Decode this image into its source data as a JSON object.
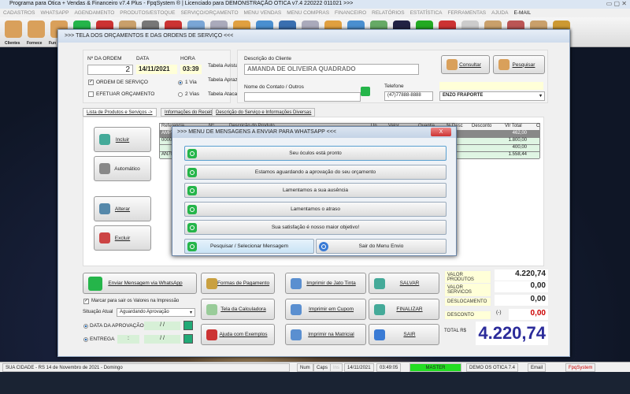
{
  "app": {
    "title": "Programa para Otica + Vendas & Financeiro v7.4 Plus - FpqSystem ® | Licenciado para  DEMONSTRAÇÃO OTICA v7.4 220222 011021 >>>"
  },
  "menu": [
    "CADASTROS",
    "WHATSAPP",
    "AGENDAMENTO",
    "PRODUTOS/ESTOQUE",
    "SERVIÇO/ORÇAMENTO",
    "MENU VENDAS",
    "MENU COMPRAS",
    "FINANCEIRO",
    "RELATÓRIOS",
    "ESTATÍSTICA",
    "FERRAMENTAS",
    "AJUDA",
    "E-MAIL"
  ],
  "toolbar": {
    "labels": [
      "Clientes",
      "Fornece",
      "Fun"
    ]
  },
  "window": {
    "title": ">>>  TELA DOS ORÇAMENTOS E DAS ORDENS DE SERVIÇO  <<<"
  },
  "order": {
    "num_label": "Nº DA ORDEM",
    "num": "2",
    "date_label": "DATA",
    "date": "14/11/2021",
    "time_label": "HORA",
    "time": "03:39",
    "os_label": "ORDEM DE SERVIÇO",
    "orc_label": "EFETUAR ORÇAMENTO",
    "via1": "1 Via",
    "via2": "2 Vias",
    "t_avista": "Tabela Avista",
    "t_aprazo": "Tabela Aprazo",
    "t_atacado": "Tabela Atacado"
  },
  "client": {
    "desc_label": "Descrição do Cliente",
    "name": "AMANDA DE OLIVEIRA QUADRADO",
    "contact_label": "Nome do Contato / Outros",
    "contact": "",
    "phone_label": "Telefone",
    "phone": "(47)77888-8888",
    "seller": "ENZO FRAPORTE",
    "consultar": "Consultar",
    "pesquisar": "Pesquisar"
  },
  "tabs": [
    "Lista de Produtos e Serviços ->",
    "Informações do Receituário ->",
    "Descrição do Serviço e Informações Diversas"
  ],
  "side": {
    "incluir": "Incluir",
    "automatico": "Automático",
    "alterar": "Alterar",
    "excluir": "Excluir"
  },
  "grid": {
    "headers": [
      "Referencia",
      "Nº",
      "Descrição do Produto",
      "Un",
      "Valor",
      "Quantia",
      "% Desc",
      "Desconto",
      "Vlr Total",
      "C"
    ],
    "rows": [
      {
        "ref": "AMP",
        "total": "462,00"
      },
      {
        "ref": "00000",
        "total": "1.800,00"
      },
      {
        "ref": "",
        "total": "400,00"
      },
      {
        "ref": "AN70",
        "total": "1.558,44"
      }
    ]
  },
  "dialog": {
    "title": ">>> MENU DE MENSAGENS A ENVIAR PARA WHATSAPP <<<",
    "close": "X",
    "messages": [
      "Seu óculos está pronto",
      "Estamos aguardando a aprovação do seu orçamento",
      "Lamentamos a sua ausência",
      "Lamentamos o atraso",
      "Sua satisfação é nosso maior objetivo!"
    ],
    "search": "Pesquisar / Selecionar Mensagem",
    "exit": "Sair do Menu Envio"
  },
  "bottom": {
    "whatsapp": "Enviar Mensagem via WhatsApp",
    "marcar": "Marcar para sair os Valores na Impressão",
    "situacao_label": "Situação Atual",
    "situacao": "Aguardando Aprovação",
    "data_aprov": "DATA DA APROVAÇÃO",
    "entrega": "ENTREGA",
    "date_blank": "/ /",
    "time_blank": ":",
    "formas": "Formas de Pagamento",
    "calc": "Tela da Calculadora",
    "ajuda": "Ajuda com Exemplos",
    "jato": "Imprimir de Jato Tinta",
    "cupom": "Imprimir em Cupom",
    "matricial": "Imprimir na Matricial",
    "salvar": "SALVAR",
    "finalizar": "FINALIZAR",
    "sair": "SAIR"
  },
  "totals": {
    "produtos_label": "VALOR PRODUTOS",
    "produtos": "4.220,74",
    "servicos_label": "VALOR SERVICOS",
    "servicos": "0,00",
    "desloc_label": "DESLOCAMENTO",
    "desloc": "0,00",
    "desconto_label": "DESCONTO",
    "desconto_sign": "(-)",
    "desconto": "0,00",
    "total_label": "TOTAL R$",
    "total": "4.220,74"
  },
  "status": {
    "city": "SUA CIDADE - RS 14 de Novembro de 2021 - Domingo",
    "num": "Num",
    "caps": "Caps",
    "ins": "Ins",
    "date": "14/11/2021",
    "time": "03:49:05",
    "user": "MASTER",
    "version": "DEMO OS OTICA 7.4",
    "email": "Email",
    "brand": "FpqSystem"
  },
  "colors": {
    "whatsapp": "#25b54a",
    "total": "#2b2b9a",
    "discount": "#cc0000",
    "master": "#22dd22"
  }
}
